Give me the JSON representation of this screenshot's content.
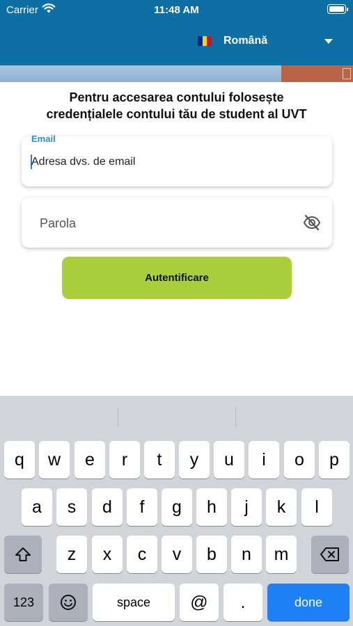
{
  "status_bar": {
    "carrier": "Carrier",
    "time": "11:48 AM",
    "wifi_icon": "wifi-icon",
    "battery_icon": "battery-icon"
  },
  "header": {
    "language_label": "Română",
    "flag_icon": "romania-flag-icon",
    "flag_colors": [
      "#002B7F",
      "#FCD116",
      "#CE1126"
    ],
    "dropdown_icon": "caret-down-icon"
  },
  "intro": {
    "line1": "Pentru accesarea contului folosește",
    "line2": "credențialele contului tău de student al UVT"
  },
  "email_field": {
    "label": "Email",
    "placeholder": "Adresa dvs. de email"
  },
  "password_field": {
    "placeholder": "Parola",
    "visibility_icon": "eye-off-icon"
  },
  "login_button": {
    "label": "Autentificare",
    "color": "#A9CF3D"
  },
  "keyboard": {
    "row1": [
      "q",
      "w",
      "e",
      "r",
      "t",
      "y",
      "u",
      "i",
      "o",
      "p"
    ],
    "row2": [
      "a",
      "s",
      "d",
      "f",
      "g",
      "h",
      "j",
      "k",
      "l"
    ],
    "row3": [
      "z",
      "x",
      "c",
      "v",
      "b",
      "n",
      "m"
    ],
    "shift_icon": "shift-icon",
    "backspace_icon": "backspace-icon",
    "numbers_label": "123",
    "emoji_icon": "emoji-icon",
    "space_label": "space",
    "at_label": "@",
    "dot_label": ".",
    "done_label": "done"
  }
}
